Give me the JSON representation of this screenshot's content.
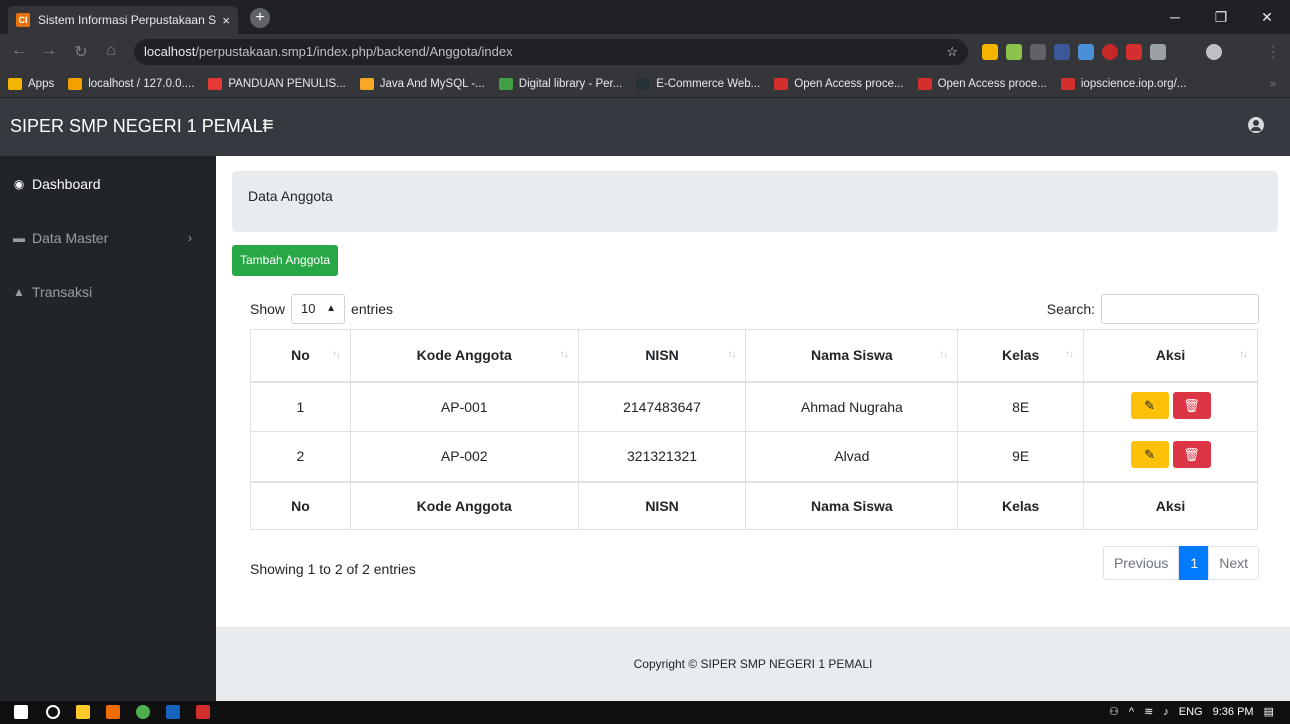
{
  "browser": {
    "tab_title": "Sistem Informasi Perpustakaan SI",
    "tab_close": "×",
    "new_tab": "+",
    "url_host": "localhost",
    "url_path": "/perpustakaan.smp1/index.php/backend/Anggota/index",
    "window_min": "─",
    "window_restore": "❐",
    "window_close": "✕",
    "bookmarks": [
      {
        "label": "Apps",
        "icon": "apps-icon",
        "color": "#f4b400"
      },
      {
        "label": "localhost / 127.0.0....",
        "icon": "phpmyadmin-icon",
        "color": "#f4a100"
      },
      {
        "label": "PANDUAN PENULIS...",
        "icon": "pdf-icon",
        "color": "#e53935"
      },
      {
        "label": "Java And MySQL -...",
        "icon": "slideshare-icon",
        "color": "#f9a825"
      },
      {
        "label": "Digital library - Per...",
        "icon": "green-doc-icon",
        "color": "#43a047"
      },
      {
        "label": "E-Commerce Web...",
        "icon": "pkp-icon",
        "color": "#263238"
      },
      {
        "label": "Open Access proce...",
        "icon": "iop-icon",
        "color": "#d32f2f"
      },
      {
        "label": "Open Access proce...",
        "icon": "iop-icon",
        "color": "#d32f2f"
      },
      {
        "label": "iopscience.iop.org/...",
        "icon": "iop-icon",
        "color": "#d32f2f"
      }
    ]
  },
  "app": {
    "brand": "SIPER SMP NEGERI 1 PEMALI",
    "menu_icon": "≡"
  },
  "sidebar": {
    "items": [
      {
        "label": "Dashboard",
        "icon": "dashboard-icon",
        "glyph": "◉"
      },
      {
        "label": "Data Master",
        "icon": "folder-icon",
        "glyph": "▬",
        "chevron": "›"
      },
      {
        "label": "Transaksi",
        "icon": "chart-icon",
        "glyph": "▲"
      }
    ]
  },
  "main": {
    "breadcrumb": "Data Anggota",
    "add_button": "Tambah Anggota",
    "show_label": "Show",
    "entries_value": "10",
    "entries_label": "entries",
    "search_label": "Search:",
    "columns": [
      "No",
      "Kode Anggota",
      "NISN",
      "Nama Siswa",
      "Kelas",
      "Aksi"
    ],
    "rows": [
      {
        "no": "1",
        "kode": "AP-001",
        "nisn": "2147483647",
        "nama": "Ahmad Nugraha",
        "kelas": "8E"
      },
      {
        "no": "2",
        "kode": "AP-002",
        "nisn": "321321321",
        "nama": "Alvad",
        "kelas": "9E"
      }
    ],
    "edit_glyph": "✎",
    "delete_glyph": "🗑",
    "info": "Showing 1 to 2 of 2 entries",
    "pagination": {
      "previous": "Previous",
      "current": "1",
      "next": "Next"
    },
    "footer": "Copyright © SIPER SMP NEGERI 1 PEMALI"
  },
  "taskbar": {
    "lang": "ENG",
    "time": "9:36 PM"
  },
  "colors": {
    "success": "#28a745",
    "warning": "#ffc107",
    "danger": "#dc3545",
    "primary": "#007bff",
    "navbar": "#343a40",
    "sidebar": "#212529"
  }
}
